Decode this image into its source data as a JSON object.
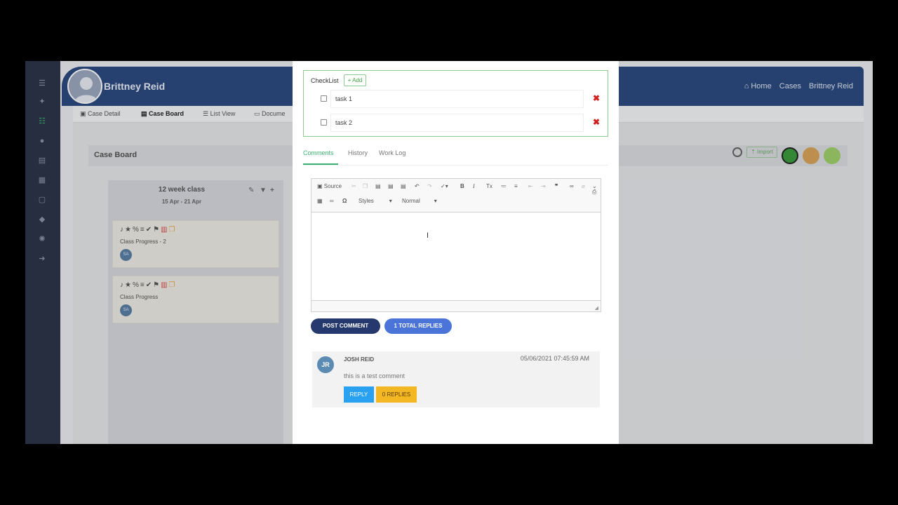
{
  "header": {
    "user_name": "Brittney Reid",
    "breadcrumb": [
      "Home",
      "Cases",
      "Brittney Reid"
    ]
  },
  "tabs": [
    "Case Detail",
    "Case Board",
    "List View",
    "Docume"
  ],
  "board": {
    "title": "Case Board",
    "import_label": "Import",
    "column": {
      "title": "12 week class",
      "dates": "15 Apr - 21 Apr",
      "cards": [
        {
          "title": "Class Progress - 2",
          "avatar": "SA"
        },
        {
          "title": "Class Progress",
          "avatar": "SA"
        }
      ]
    }
  },
  "modal": {
    "checklist": {
      "title": "CheckList",
      "add_label": "Add",
      "tasks": [
        "task 1",
        "task 2"
      ]
    },
    "comment_tabs": [
      "Comments",
      "History",
      "Work Log"
    ],
    "editor": {
      "source_label": "Source",
      "styles_label": "Styles",
      "format_label": "Normal"
    },
    "post_comment_label": "POST COMMENT",
    "total_replies_label": "1 TOTAL REPLIES",
    "comment": {
      "initials": "JR",
      "author": "JOSH REID",
      "date": "05/06/2021 07:45:59 AM",
      "text": "this is a test comment",
      "reply_label": "REPLY",
      "replies_label": "0 REPLIES"
    }
  },
  "colors": {
    "header_bg": "#2c4a7f",
    "accent_green": "#3bb273",
    "post_btn": "#26396e",
    "replies_btn": "#4b74d8",
    "reply_btn": "#2aa0f0",
    "zero_replies_btn": "#f3b724",
    "delete_red": "#d21f1f"
  }
}
